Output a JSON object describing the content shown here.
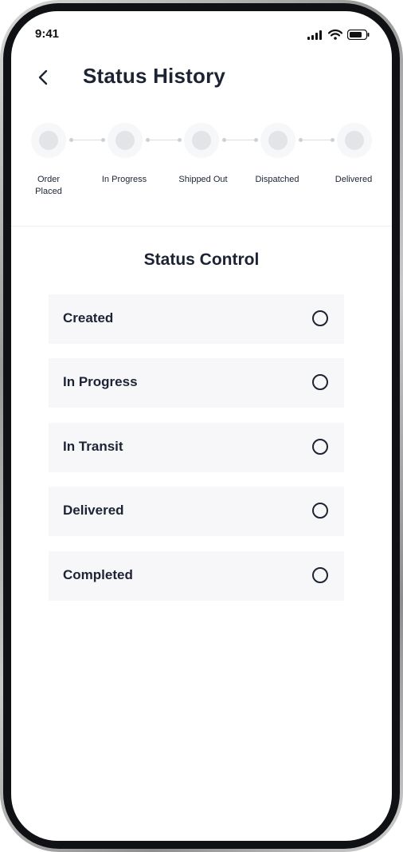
{
  "status_bar": {
    "time": "9:41"
  },
  "header": {
    "title": "Status History",
    "back_icon": "chevron-left-icon"
  },
  "stepper": {
    "steps": [
      {
        "label": "Order\nPlaced"
      },
      {
        "label": "In Progress"
      },
      {
        "label": "Shipped Out"
      },
      {
        "label": "Dispatched"
      },
      {
        "label": "Delivered"
      }
    ]
  },
  "status_control": {
    "title": "Status Control",
    "options": [
      {
        "label": "Created",
        "selected": false
      },
      {
        "label": "In Progress",
        "selected": false
      },
      {
        "label": "In Transit",
        "selected": false
      },
      {
        "label": "Delivered",
        "selected": false
      },
      {
        "label": "Completed",
        "selected": false
      }
    ]
  },
  "colors": {
    "text": "#1c2433",
    "option_bg": "#f7f7f9",
    "step_fill": "#e3e4e8"
  }
}
